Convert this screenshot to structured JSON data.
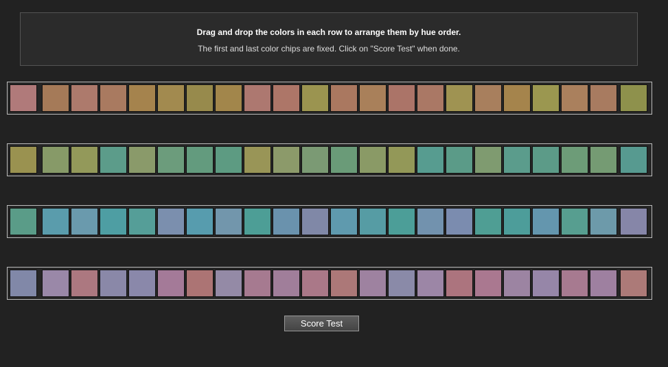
{
  "instructions": {
    "title": "Drag and drop the colors in each row to arrange them by hue order.",
    "subtitle": "The first and last color chips are fixed. Click on \"Score Test\" when done."
  },
  "rows": [
    {
      "fixed_first": "#b07a7a",
      "chips": [
        "#a57a58",
        "#ad7a6c",
        "#a97a60",
        "#a5834d",
        "#a28a4f",
        "#978a4c",
        "#a2864b",
        "#ad7870",
        "#ad7668",
        "#9b9450",
        "#aa7860",
        "#a9805a",
        "#ab7468",
        "#aa7865",
        "#9f9352",
        "#a87f5d",
        "#a5844c",
        "#9b9750",
        "#aa805d",
        "#a87b60"
      ],
      "fixed_last": "#8e914c"
    },
    {
      "fixed_first": "#9a9250",
      "chips": [
        "#879a68",
        "#93995a",
        "#5c9c8a",
        "#8a9a6a",
        "#6c9c7c",
        "#639b7e",
        "#5d9b82",
        "#999557",
        "#8c9a6a",
        "#7b9a74",
        "#6a9b78",
        "#8a9a66",
        "#939858",
        "#579c90",
        "#5b9b88",
        "#7f9b70",
        "#5b9c8c",
        "#5c9b88",
        "#6d9c78",
        "#759b73"
      ],
      "fixed_last": "#579a90"
    },
    {
      "fixed_first": "#5a9c88",
      "chips": [
        "#5a9cac",
        "#6a9aad",
        "#4e9ea3",
        "#559e98",
        "#7b8fae",
        "#579cae",
        "#7296ac",
        "#4d9e96",
        "#6a92ad",
        "#8088a7",
        "#5f9aae",
        "#569ca4",
        "#4c9e98",
        "#7292ae",
        "#7b8caf",
        "#4f9e94",
        "#4d9d9a",
        "#6496ae",
        "#579e90",
        "#6d9aaa"
      ],
      "fixed_last": "#8686a8"
    },
    {
      "fixed_first": "#8188a8",
      "chips": [
        "#9a88a8",
        "#ac7880",
        "#8a88a8",
        "#8a88aa",
        "#a47a98",
        "#ac7474",
        "#948aa6",
        "#a67a90",
        "#a07e9a",
        "#aa7888",
        "#ac7878",
        "#9e82a0",
        "#8a8aa8",
        "#9c86a6",
        "#ac747e",
        "#aa7890",
        "#9c84a2",
        "#9686a8",
        "#a77a90",
        "#9e80a0"
      ],
      "fixed_last": "#ac7a78"
    }
  ],
  "score_button": {
    "label": "Score Test"
  }
}
